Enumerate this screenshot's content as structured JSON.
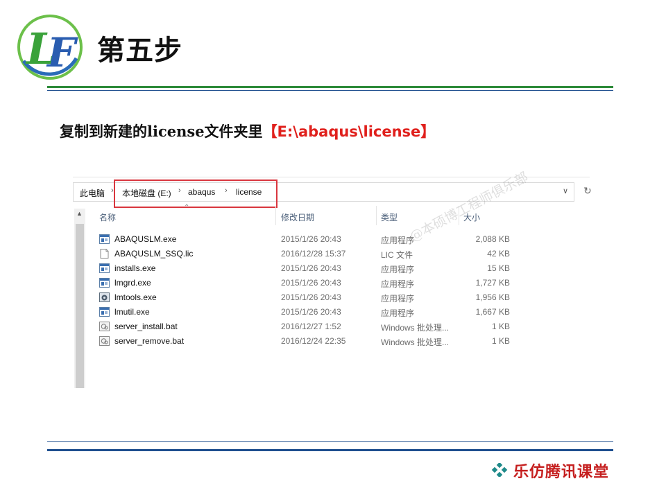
{
  "slide": {
    "logo_text": "LF",
    "title": "第五步",
    "instruction_main": "复制到新建的license文件夹里",
    "instruction_path": "【E:\\abaqus\\license】",
    "footer_brand": "乐仿腾讯课堂",
    "watermark": "@本硕博工程师俱乐部"
  },
  "explorer": {
    "breadcrumb": {
      "root": "此电脑",
      "drive": "本地磁盘 (E:)",
      "folder1": "abaqus",
      "folder2": "license",
      "separator": "›"
    },
    "columns": {
      "name": "名称",
      "modified": "修改日期",
      "type": "类型",
      "size": "大小"
    },
    "files": [
      {
        "name": "ABAQUSLM.exe",
        "modified": "2015/1/26 20:43",
        "type": "应用程序",
        "size": "2,088 KB",
        "icon": "exe-icon"
      },
      {
        "name": "ABAQUSLM_SSQ.lic",
        "modified": "2016/12/28 15:37",
        "type": "LIC 文件",
        "size": "42 KB",
        "icon": "file-icon"
      },
      {
        "name": "installs.exe",
        "modified": "2015/1/26 20:43",
        "type": "应用程序",
        "size": "15 KB",
        "icon": "exe-icon"
      },
      {
        "name": "lmgrd.exe",
        "modified": "2015/1/26 20:43",
        "type": "应用程序",
        "size": "1,727 KB",
        "icon": "exe-icon"
      },
      {
        "name": "lmtools.exe",
        "modified": "2015/1/26 20:43",
        "type": "应用程序",
        "size": "1,956 KB",
        "icon": "tool-exe-icon"
      },
      {
        "name": "lmutil.exe",
        "modified": "2015/1/26 20:43",
        "type": "应用程序",
        "size": "1,667 KB",
        "icon": "exe-icon"
      },
      {
        "name": "server_install.bat",
        "modified": "2016/12/27 1:52",
        "type": "Windows 批处理...",
        "size": "1 KB",
        "icon": "bat-icon"
      },
      {
        "name": "server_remove.bat",
        "modified": "2016/12/24 22:35",
        "type": "Windows 批处理...",
        "size": "1 KB",
        "icon": "bat-icon"
      }
    ]
  },
  "colors": {
    "green_rule": "#2e8b3a",
    "blue_rule": "#1f4f8f",
    "highlight_red": "#e0201c",
    "address_box": "#d9363e"
  }
}
